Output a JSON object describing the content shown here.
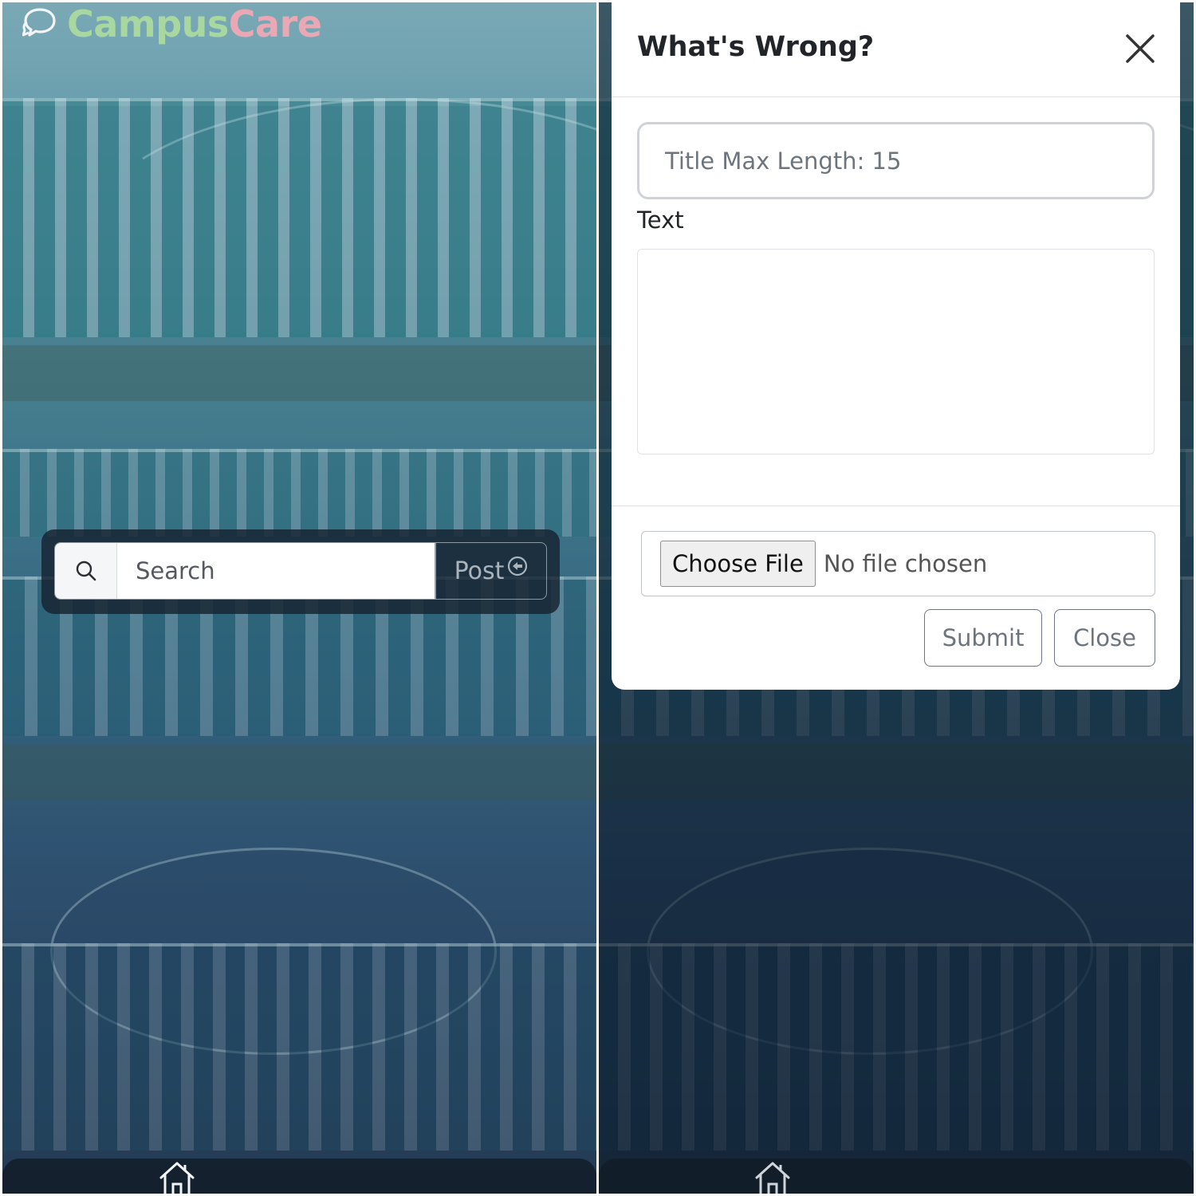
{
  "app": {
    "brand_part1": "Campus",
    "brand_part2": "Care",
    "brand_color1": "#a8d8a0",
    "brand_color2": "#e9a8b4",
    "brand_icon": "chat-bubbles-icon"
  },
  "search": {
    "placeholder": "Search",
    "icon": "search-icon",
    "post_label": "Post",
    "post_icon": "arrow-circle-icon"
  },
  "bottom_nav": {
    "items": [
      {
        "icon": "home-icon"
      }
    ]
  },
  "modal": {
    "title": "What's Wrong?",
    "close_icon": "close-icon",
    "title_placeholder": "Title Max Length: 15",
    "text_label": "Text",
    "text_value": "",
    "file_button_label": "Choose File",
    "file_status": "No file chosen",
    "submit_label": "Submit",
    "close_label": "Close"
  }
}
